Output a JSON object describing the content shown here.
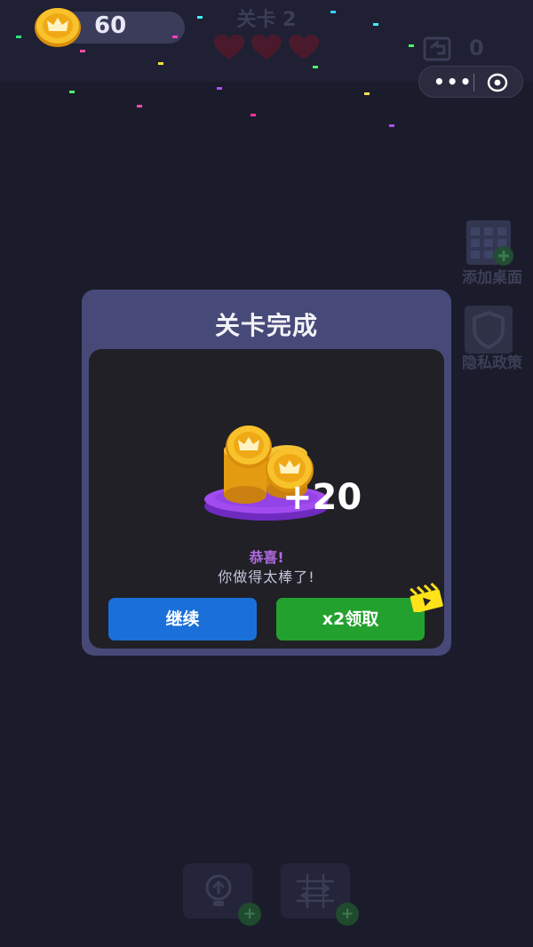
{
  "hud": {
    "coins": "60",
    "level_title": "关卡 2",
    "hearts": 3,
    "undo_count": "0"
  },
  "capsule": {
    "more_label": "•••"
  },
  "side_buttons": {
    "add_desktop": "添加桌面",
    "privacy": "隐私政策"
  },
  "modal": {
    "title": "关卡完成",
    "reward_amount": "+20",
    "congrats": "恭喜!",
    "praise": "你做得太棒了!",
    "continue_label": "继续",
    "double_label": "x2领取"
  },
  "colors": {
    "background": "#1b1c2b",
    "modal_frame": "#474a78",
    "modal_inner": "#202026",
    "continue_button": "#1a70d8",
    "double_button": "#23a12e",
    "congrats_text": "#b26be0",
    "coin_gold": "#f5b21a"
  },
  "icons": {
    "coin": "crown-coin-icon",
    "heart": "heart-icon",
    "undo": "undo-icon",
    "more": "more-dots-icon",
    "record": "record-eye-icon",
    "add_desktop": "calendar-grid-icon",
    "privacy": "shield-icon",
    "hint": "lightbulb-icon",
    "shuffle": "shuffle-grid-icon",
    "video": "clapperboard-icon"
  }
}
